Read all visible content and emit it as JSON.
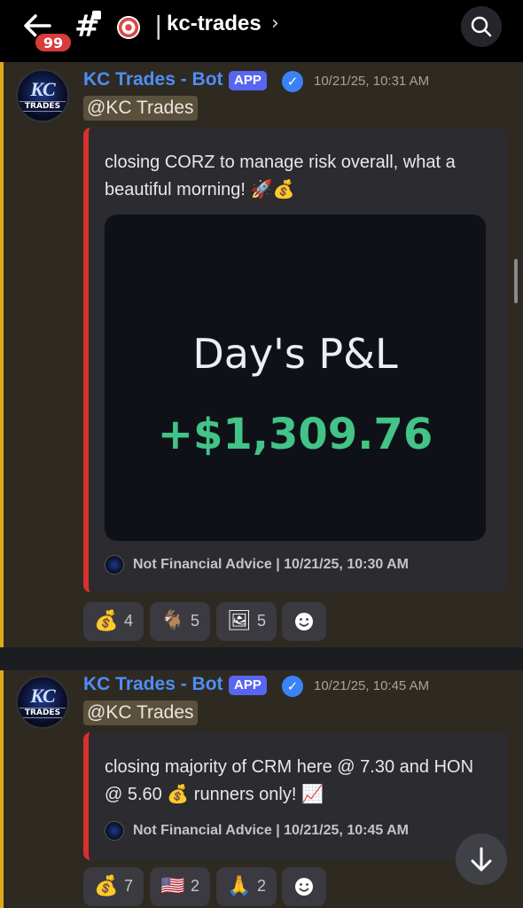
{
  "header": {
    "unread_count": "99",
    "channel_name": "kc-trades",
    "icons": [
      "back-arrow-icon",
      "hash-lock-icon",
      "target-icon",
      "chevron-right-icon",
      "search-icon"
    ]
  },
  "messages": [
    {
      "author": "KC Trades - Bot",
      "app_tag": "APP",
      "timestamp": "10/21/25, 10:31 AM",
      "avatar_text": "KC",
      "avatar_subtext": "TRADES",
      "mention": "@KC Trades",
      "embed": {
        "description": "closing CORZ to manage risk overall, what a beautiful morning! 🚀💰",
        "image": {
          "title": "Day's P&L",
          "value": "+$1,309.76"
        },
        "footer": "Not Financial Advice | 10/21/25, 10:30 AM"
      },
      "reactions": [
        {
          "emoji": "💰",
          "count": "4"
        },
        {
          "emoji": "🐐",
          "count": "5"
        },
        {
          "emoji": "🖼",
          "count": "5"
        }
      ]
    },
    {
      "author": "KC Trades - Bot",
      "app_tag": "APP",
      "timestamp": "10/21/25, 10:45 AM",
      "avatar_text": "KC",
      "avatar_subtext": "TRADES",
      "mention": "@KC Trades",
      "embed": {
        "description": "closing majority of CRM here @ 7.30 and HON @ 5.60 💰 runners only! 📈",
        "footer": "Not Financial Advice | 10/21/25, 10:45 AM"
      },
      "reactions": [
        {
          "emoji": "💰",
          "count": "7"
        },
        {
          "emoji": "🇺🇸",
          "count": "2"
        },
        {
          "emoji": "🙏",
          "count": "2"
        }
      ]
    }
  ],
  "colors": {
    "accent_link": "#4e8ef6",
    "embed_border": "#d9302c",
    "pnl_green": "#43c387",
    "mention_bar": "#e0a91c",
    "badge_red": "#d93a3a"
  }
}
